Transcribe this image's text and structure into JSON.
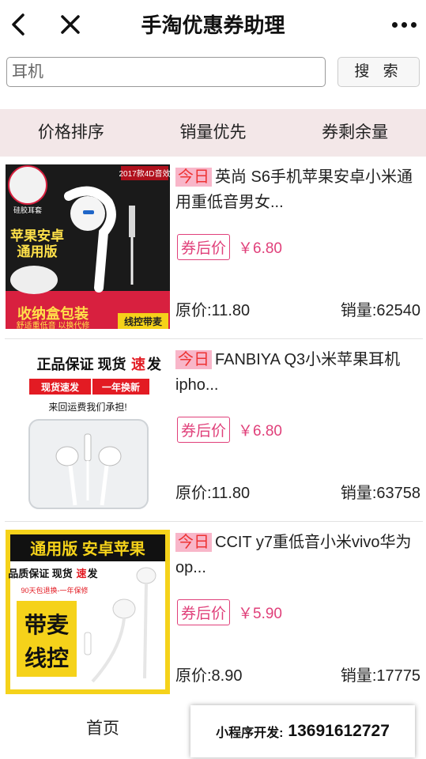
{
  "header": {
    "title": "手淘优惠券助理"
  },
  "search": {
    "placeholder": "耳机",
    "button_label": "搜 索"
  },
  "sort_tabs": [
    "价格排序",
    "销量优先",
    "券剩余量"
  ],
  "products": [
    {
      "today_tag": "今日",
      "title": "英尚 S6手机苹果安卓小米通用重低音男女...",
      "coupon_label": "券后价",
      "coupon_price": "￥6.80",
      "original_price": "原价:11.80",
      "sales": "销量:62540",
      "image_text": {
        "top_badge": "2017款4D音效",
        "earpad": "硅胶耳套",
        "line1": "苹果安卓",
        "line2": "通用版",
        "bottom1": "收纳盒包装",
        "bottom2": "舒适重低音 以换代修",
        "bottom_badge": "线控带麦"
      }
    },
    {
      "today_tag": "今日",
      "title": "FANBIYA Q3小米苹果耳机ipho...",
      "coupon_label": "券后价",
      "coupon_price": "￥6.80",
      "original_price": "原价:11.80",
      "sales": "销量:63758",
      "image_text": {
        "headline_a": "正品保证 现货",
        "headline_b": "速",
        "headline_c": "发",
        "badge1": "现货速发",
        "badge2": "一年换新",
        "sub": "来回运费我们承担!"
      }
    },
    {
      "today_tag": "今日",
      "title": "CCIT y7重低音小米vivo华为op...",
      "coupon_label": "券后价",
      "coupon_price": "￥5.90",
      "original_price": "原价:8.90",
      "sales": "销量:17775",
      "image_text": {
        "banner": "通用版 安卓苹果",
        "line1a": "品质保证 现货",
        "line1b": "速",
        "line1c": "发",
        "line2": "90天包退换-一年保修",
        "big1": "带麦",
        "big2": "线控"
      }
    }
  ],
  "bottom": {
    "home_label": "首页",
    "promo_label": "小程序开发:",
    "promo_phone": "13691612727"
  },
  "colors": {
    "accent_pink": "#e0407a",
    "today_bg": "#f8b6c9",
    "sort_bg": "#f3e7e8"
  }
}
